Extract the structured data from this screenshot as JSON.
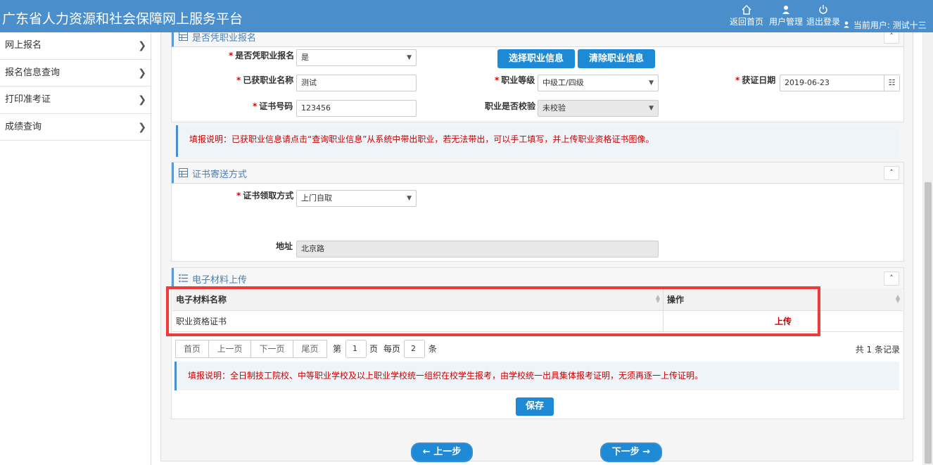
{
  "header": {
    "title": "广东省人力资源和社会保障网上服务平台",
    "nav": {
      "home": "返回首页",
      "user_mgmt": "用户管理",
      "logout": "退出登录",
      "current_user_label": "当前用户:",
      "current_user_name": "测试十三"
    }
  },
  "sidebar": {
    "items": [
      {
        "label": "网上报名"
      },
      {
        "label": "报名信息查询"
      },
      {
        "label": "打印准考证"
      },
      {
        "label": "成绩查询"
      }
    ]
  },
  "section1": {
    "title": "是否凭职业报名",
    "fields": {
      "is_by_occupation": {
        "label": "是否凭职业报名",
        "value": "是"
      },
      "occupation_name": {
        "label": "已获职业名称",
        "value": "测试"
      },
      "cert_no": {
        "label": "证书号码",
        "value": "123456"
      },
      "occupation_level": {
        "label": "职业等级",
        "value": "中级工/四级"
      },
      "verified": {
        "label": "职业是否校验",
        "value": "未校验"
      },
      "obtain_date": {
        "label": "获证日期",
        "value": "2019-06-23"
      }
    },
    "buttons": {
      "select": "选择职业信息",
      "clear": "清除职业信息"
    },
    "notice": "填报说明：已获职业信息请点击“查询职业信息”从系统中带出职业，若无法带出，可以手工填写，并上传职业资格证书图像。"
  },
  "section2": {
    "title": "证书寄送方式",
    "fields": {
      "collect_method": {
        "label": "证书领取方式",
        "value": "上门自取"
      },
      "address": {
        "label": "地址",
        "value": "北京路"
      }
    }
  },
  "section3": {
    "title": "电子材料上传",
    "table": {
      "columns": [
        "电子材料名称",
        "操作"
      ],
      "rows": [
        {
          "name": "职业资格证书",
          "action": "上传"
        }
      ]
    },
    "pager": {
      "first": "首页",
      "prev": "上一页",
      "next": "下一页",
      "last": "尾页",
      "page_prefix": "第",
      "page_value": "1",
      "page_suffix": "页",
      "per_page_prefix": "每页",
      "per_page_value": "2",
      "per_page_suffix": "条",
      "total": "共 1 条记录"
    },
    "notice": "填报说明：全日制技工院校、中等职业学校及以上职业学校统一组织在校学生报考，由学校统一出具集体报考证明，无须再逐一上传证明。",
    "save": "保存"
  },
  "steps": {
    "prev": "← 上一步",
    "next": "下一步 →"
  },
  "colors": {
    "header_bg": "#4a8fcb",
    "primary_button": "#1e8ad6",
    "notice_text": "#cc0000",
    "highlight_box": "#f03a3a"
  }
}
